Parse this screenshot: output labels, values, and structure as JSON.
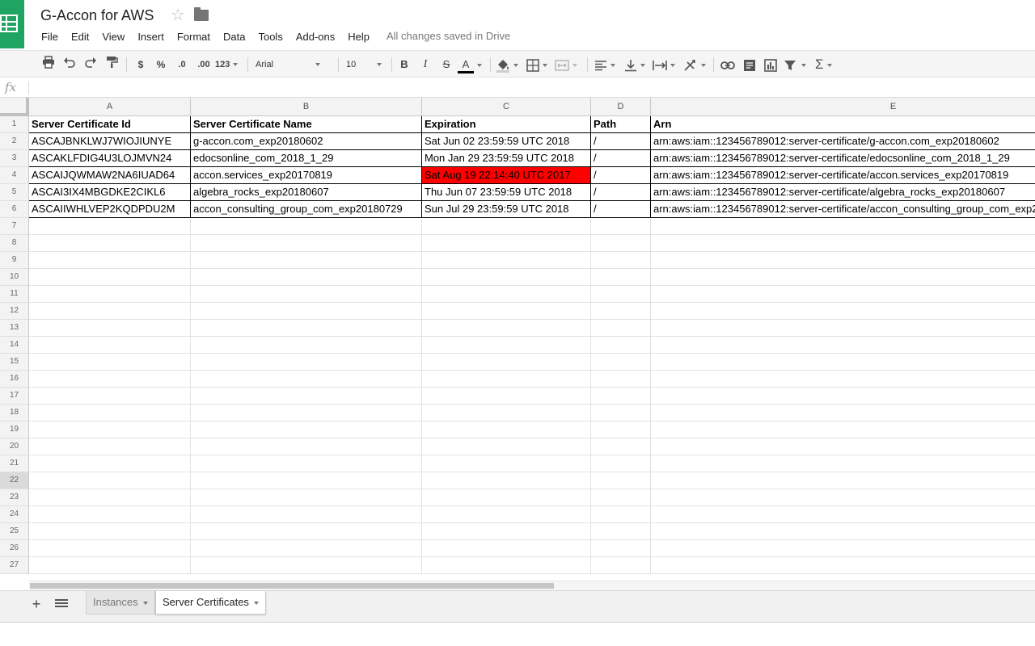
{
  "app": {
    "title": "G-Accon for AWS",
    "save_status": "All changes saved in Drive",
    "brand_color": "#1fa463",
    "menu": [
      "File",
      "Edit",
      "View",
      "Insert",
      "Format",
      "Data",
      "Tools",
      "Add-ons",
      "Help"
    ]
  },
  "toolbar": {
    "currency_label": "$",
    "percent_label": "%",
    "decrease_decimal_label": ".0",
    "increase_decimal_label": ".00",
    "number_format_label": "123",
    "font_family": "Arial",
    "font_size": "10",
    "bold_label": "B",
    "italic_label": "I",
    "strike_label": "S",
    "text_color_label": "A"
  },
  "formula_bar": {
    "icon_label": "fx",
    "value": ""
  },
  "grid": {
    "columns": [
      "A",
      "B",
      "C",
      "D",
      "E"
    ],
    "rows": [
      "1",
      "2",
      "3",
      "4",
      "5",
      "6",
      "7",
      "8",
      "9",
      "10",
      "11",
      "12",
      "13",
      "14",
      "15",
      "16",
      "17",
      "18",
      "19",
      "20",
      "21",
      "22",
      "23",
      "24",
      "25",
      "26",
      "27"
    ],
    "active_row": "22",
    "header": {
      "id": "Server Certificate Id",
      "name": "Server Certificate Name",
      "expiration": "Expiration",
      "path": "Path",
      "arn": "Arn"
    },
    "expired_color": "#ff0000",
    "data": [
      {
        "id": "ASCAJBNKLWJ7WIOJIUNYE",
        "name": "g-accon.com_exp20180602",
        "expiration": "Sat Jun 02 23:59:59 UTC 2018",
        "path": "/",
        "arn": "arn:aws:iam::123456789012:server-certificate/g-accon.com_exp20180602",
        "expired": false
      },
      {
        "id": "ASCAKLFDIG4U3LOJMVN24",
        "name": "edocsonline_com_2018_1_29",
        "expiration": "Mon Jan 29 23:59:59 UTC 2018",
        "path": "/",
        "arn": "arn:aws:iam::123456789012:server-certificate/edocsonline_com_2018_1_29",
        "expired": false
      },
      {
        "id": "ASCAIJQWMAW2NA6IUAD64",
        "name": "accon.services_exp20170819",
        "expiration": "Sat Aug 19 22:14:40 UTC 2017",
        "path": "/",
        "arn": "arn:aws:iam::123456789012:server-certificate/accon.services_exp20170819",
        "expired": true
      },
      {
        "id": "ASCAI3IX4MBGDKE2CIKL6",
        "name": "algebra_rocks_exp20180607",
        "expiration": "Thu Jun 07 23:59:59 UTC 2018",
        "path": "/",
        "arn": "arn:aws:iam::123456789012:server-certificate/algebra_rocks_exp20180607",
        "expired": false
      },
      {
        "id": "ASCAIIWHLVEP2KQDPDU2M",
        "name": "accon_consulting_group_com_exp20180729",
        "expiration": "Sun Jul 29 23:59:59 UTC 2018",
        "path": "/",
        "arn": "arn:aws:iam::123456789012:server-certificate/accon_consulting_group_com_exp2",
        "expired": false
      }
    ]
  },
  "sheets": {
    "tabs": [
      {
        "label": "Instances",
        "active": false
      },
      {
        "label": "Server Certificates",
        "active": true
      }
    ]
  }
}
